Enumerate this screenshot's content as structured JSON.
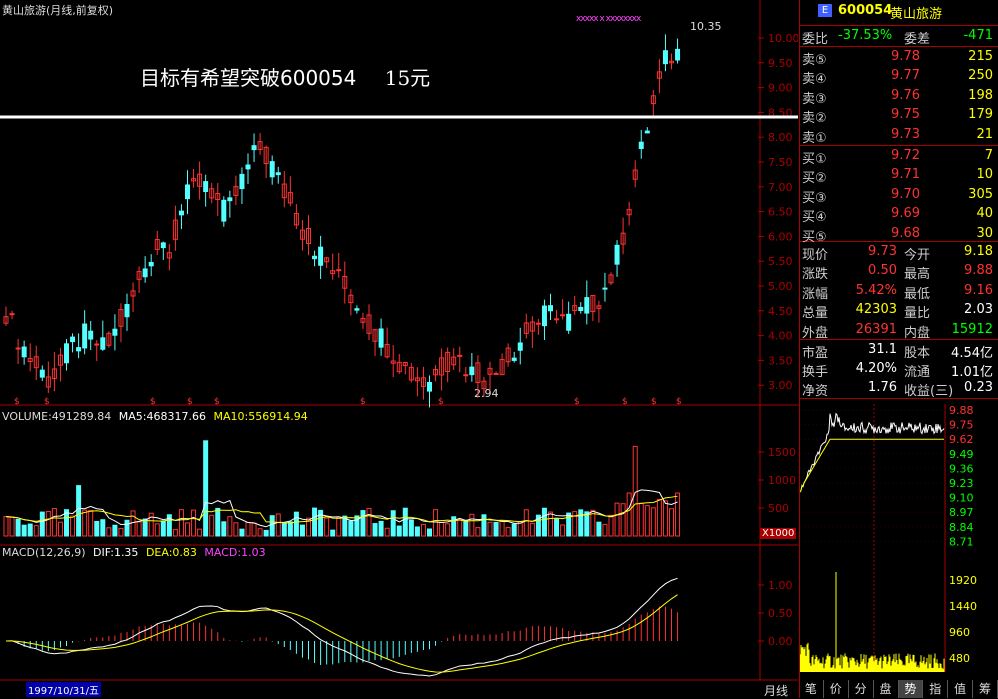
{
  "chart_header": {
    "title": "黄山旅游(月线,前复权)",
    "annotation_text": "目标有希望突破600054",
    "annotation_target": "15元",
    "high_label": "10.35",
    "low_label": "2.94",
    "x_marks": "xxxxx x xxxxxxxx"
  },
  "price_axis": [
    "10.00",
    "9.50",
    "9.00",
    "8.50",
    "8.00",
    "7.50",
    "7.00",
    "6.50",
    "6.00",
    "5.50",
    "5.00",
    "4.50",
    "4.00",
    "3.50",
    "3.00"
  ],
  "volume": {
    "label": "VOLUME:491289.84",
    "ma5": "MA5:468317.66",
    "ma10": "MA10:556914.94",
    "axis": [
      "1500",
      "1000",
      "500"
    ],
    "unit": "X1000"
  },
  "macd": {
    "label": "MACD(12,26,9)",
    "dif": "DIF:1.35",
    "dea": "DEA:0.83",
    "macd": "MACD:1.03",
    "axis": [
      "1.00",
      "0.50",
      "0.00"
    ]
  },
  "time_axis": {
    "selected_date": "1997/10/31/五",
    "period_label": "月线"
  },
  "quote": {
    "code": "600054",
    "name": "黄山旅游",
    "weibi_label": "委比",
    "weibi_value": "-37.53%",
    "weicha_label": "委差",
    "weicha_value": "-471",
    "sells": [
      {
        "label": "卖⑤",
        "price": "9.78",
        "vol": "215"
      },
      {
        "label": "卖④",
        "price": "9.77",
        "vol": "250"
      },
      {
        "label": "卖③",
        "price": "9.76",
        "vol": "198"
      },
      {
        "label": "卖②",
        "price": "9.75",
        "vol": "179"
      },
      {
        "label": "卖①",
        "price": "9.73",
        "vol": "21"
      }
    ],
    "buys": [
      {
        "label": "买①",
        "price": "9.72",
        "vol": "7"
      },
      {
        "label": "买②",
        "price": "9.71",
        "vol": "10"
      },
      {
        "label": "买③",
        "price": "9.70",
        "vol": "305"
      },
      {
        "label": "买④",
        "price": "9.69",
        "vol": "40"
      },
      {
        "label": "买⑤",
        "price": "9.68",
        "vol": "30"
      }
    ],
    "stats": [
      {
        "l1": "现价",
        "v1": "9.73",
        "l2": "今开",
        "v2": "9.18"
      },
      {
        "l1": "涨跌",
        "v1": "0.50",
        "l2": "最高",
        "v2": "9.88"
      },
      {
        "l1": "涨幅",
        "v1": "5.42%",
        "l2": "最低",
        "v2": "9.16"
      },
      {
        "l1": "总量",
        "v1": "42303",
        "l2": "量比",
        "v2": "2.03"
      },
      {
        "l1": "外盘",
        "v1": "26391",
        "l2": "内盘",
        "v2": "15912"
      }
    ],
    "fund": [
      {
        "l1": "市盈",
        "v1": "31.1",
        "l2": "股本",
        "v2": "4.54亿"
      },
      {
        "l1": "换手",
        "v1": "4.20%",
        "l2": "流通",
        "v2": "1.01亿"
      },
      {
        "l1": "净资",
        "v1": "1.76",
        "l2": "收益(三)",
        "v2": "0.23"
      }
    ]
  },
  "intraday_axis": [
    "9.88",
    "9.75",
    "9.62",
    "9.49",
    "9.36",
    "9.23",
    "9.10",
    "8.97",
    "8.84",
    "8.71"
  ],
  "intraday_vol_axis": [
    "1920",
    "1440",
    "960",
    "480"
  ],
  "tabs": [
    "笔",
    "价",
    "分",
    "盘",
    "势",
    "指",
    "值",
    "筹"
  ],
  "colors": {
    "up": "#ff3232",
    "down": "#54ffff",
    "ma5": "#ffffff",
    "ma10": "#ffff00",
    "macd_label": "#ff44ff"
  }
}
